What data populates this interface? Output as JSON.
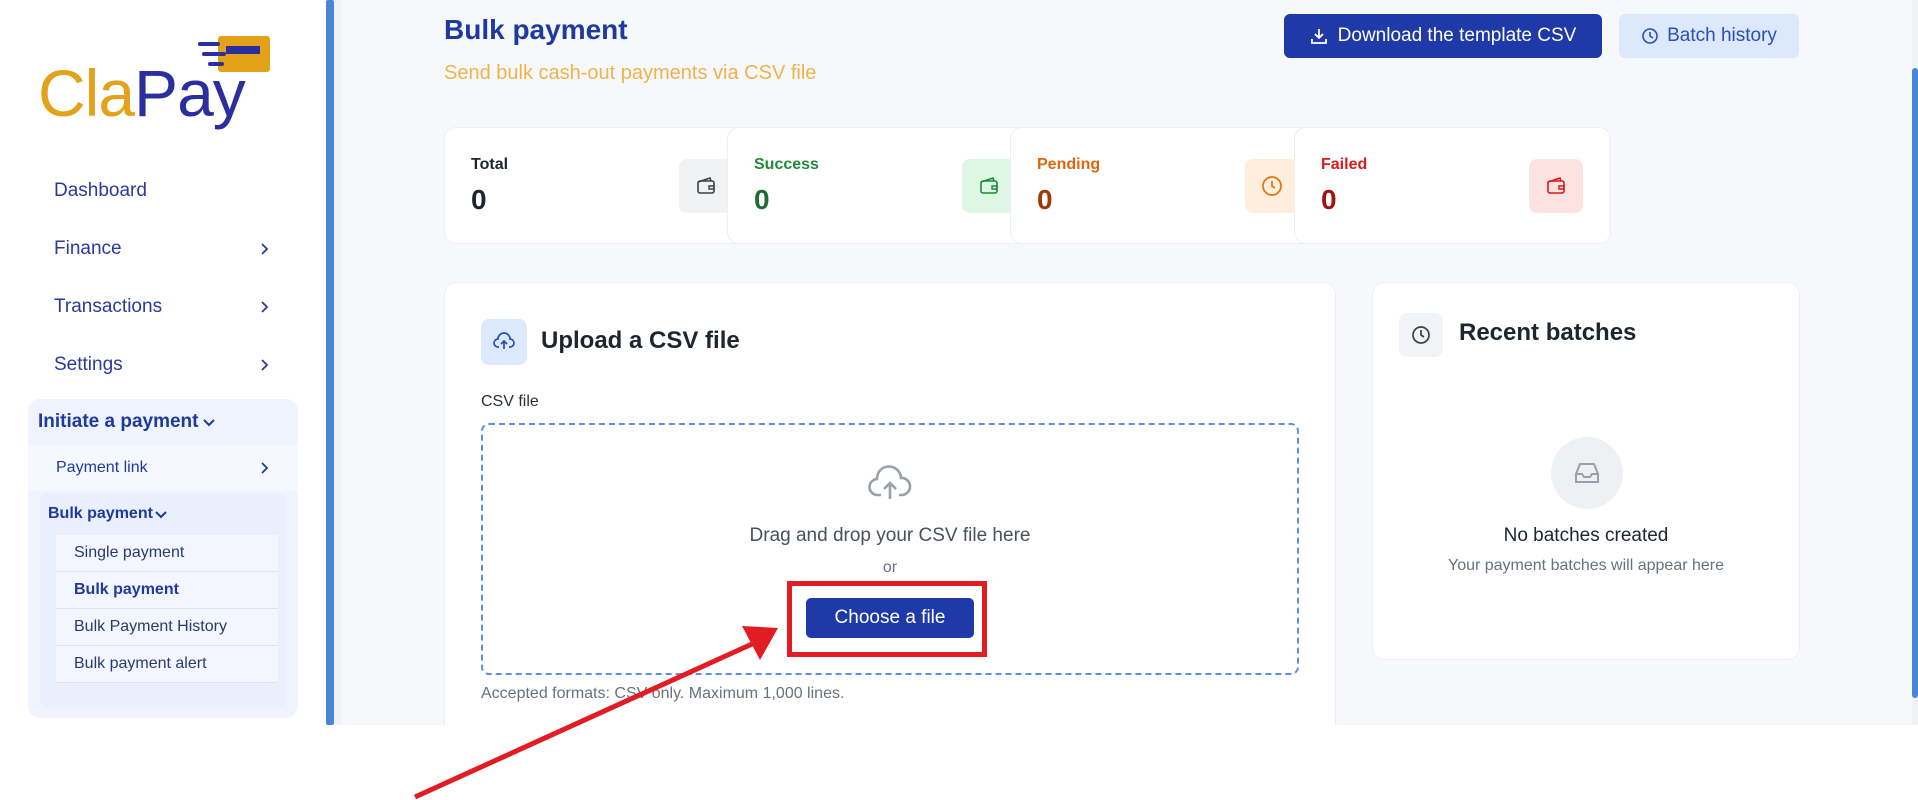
{
  "brand": {
    "part1": "Cla",
    "part2": "Pay",
    "accent": "#e3a21a",
    "primary": "#2b2f9e"
  },
  "sidebar": {
    "items": [
      {
        "label": "Dashboard",
        "has_chevron": false
      },
      {
        "label": "Finance",
        "has_chevron": true
      },
      {
        "label": "Transactions",
        "has_chevron": true
      },
      {
        "label": "Settings",
        "has_chevron": true
      }
    ],
    "group": {
      "label": "Initiate a payment",
      "payment_link": "Payment link",
      "bulk_payment": "Bulk payment",
      "children": [
        "Single payment",
        "Bulk payment",
        "Bulk Payment History",
        "Bulk payment alert"
      ],
      "active_child": "Bulk payment"
    }
  },
  "header": {
    "title": "Bulk payment",
    "subtitle": "Send bulk cash-out payments via CSV file",
    "download_label": "Download the template CSV",
    "history_label": "Batch history"
  },
  "stats": [
    {
      "label": "Total",
      "value": "0",
      "label_color": "#1e2430",
      "value_color": "#1e2430",
      "icon": "wallet-icon",
      "icon_bg": "#f1f2f4",
      "icon_color": "#3a3f4a"
    },
    {
      "label": "Success",
      "value": "0",
      "label_color": "#1f8a3a",
      "value_color": "#1f6b30",
      "icon": "wallet-icon",
      "icon_bg": "#ddf7e4",
      "icon_color": "#1f8a3a"
    },
    {
      "label": "Pending",
      "value": "0",
      "label_color": "#e0660d",
      "value_color": "#a0380a",
      "icon": "clock-icon",
      "icon_bg": "#ffeedd",
      "icon_color": "#e07a10"
    },
    {
      "label": "Failed",
      "value": "0",
      "label_color": "#d81b1b",
      "value_color": "#a01414",
      "icon": "wallet-icon",
      "icon_bg": "#fde2e2",
      "icon_color": "#d81b1b"
    }
  ],
  "upload": {
    "title": "Upload a CSV file",
    "field_label": "CSV file",
    "drop_text": "Drag and drop your CSV file here",
    "or_text": "or",
    "choose_label": "Choose a file",
    "formats_text": "Accepted formats: CSV only. Maximum 1,000 lines."
  },
  "recent": {
    "title": "Recent batches",
    "empty_title": "No batches created",
    "empty_sub": "Your payment batches will appear here"
  },
  "annotation": {
    "highlight_color": "#e31b23"
  }
}
